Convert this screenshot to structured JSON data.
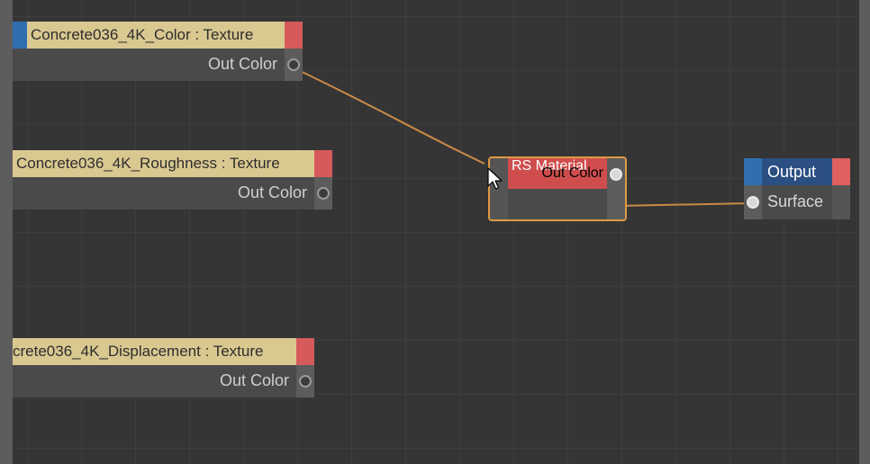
{
  "colors": {
    "canvas": "#353535",
    "texture_header": "#d9c890",
    "rs_header": "#d04d4d",
    "output_header": "#2b4f83",
    "selection_outline": "#e09a45",
    "wire": "#c98a47"
  },
  "nodes": {
    "color_texture": {
      "title": "Concrete036_4K_Color : Texture",
      "out_port": "Out Color"
    },
    "roughness_texture": {
      "title": "Concrete036_4K_Roughness : Texture",
      "out_port": "Out Color"
    },
    "displacement_texture": {
      "title": "crete036_4K_Displacement : Texture",
      "out_port": "Out Color"
    },
    "rs_material": {
      "title": "RS Material",
      "out_port": "Out Color"
    },
    "output": {
      "title": "Output",
      "in_port": "Surface"
    }
  },
  "cursor": {
    "icon": "mouse-pointer-icon"
  }
}
